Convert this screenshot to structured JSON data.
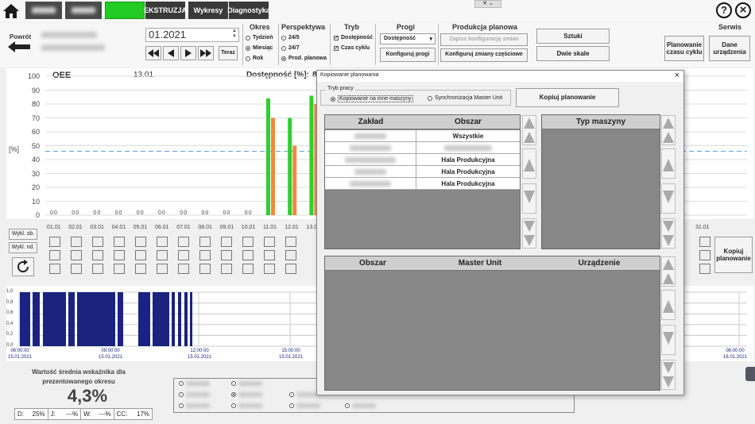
{
  "topbar": {
    "tabs": [
      {
        "label": "",
        "state": "blurred"
      },
      {
        "label": "",
        "state": "blurred"
      },
      {
        "label": "",
        "state": "active"
      },
      {
        "label": "EKSTRUZJA",
        "state": "normal"
      },
      {
        "label": "Wykresy",
        "state": "normal"
      },
      {
        "label": "Diagnostyka",
        "state": "normal"
      }
    ],
    "help_label": "?",
    "close_label": "×",
    "serwis_label": "Serwis"
  },
  "toolbar": {
    "back_label": "Powrót",
    "date_value": "01.2021",
    "today_label": "Teraz",
    "okres": {
      "title": "Okres",
      "options": [
        "Tydzień",
        "Miesiąc",
        "Rok"
      ],
      "selected": 1
    },
    "perspektywa": {
      "title": "Perspektywa",
      "options": [
        "24/5",
        "24/7",
        "Prod. planowa"
      ],
      "selected": 2
    },
    "tryb": {
      "title": "Tryb",
      "options": [
        "Dostępność",
        "Czas cyklu"
      ]
    },
    "progi": {
      "title": "Progi",
      "select_value": "Dostępność",
      "configure_label": "Konfiguruj progi"
    },
    "produkcja": {
      "title": "Produkcja planowa",
      "save_label": "Zapisz konfigurację zmian",
      "config_label": "Konfiguruj zmiany częściowe"
    },
    "sztuki_label": "Sztuki",
    "dwie_skale_label": "Dwie skale",
    "planowanie_label": "Planowanie czasu cyklu",
    "dane_label": "Dane urządzenia"
  },
  "chart": {
    "title": "OEE",
    "date_label": "13.01",
    "dostepnosc_label": "Dostępność [%]:",
    "dostepnosc_value": "8",
    "y_unit": "[%]",
    "y_ticks": [
      "100",
      "90",
      "80",
      "70",
      "60",
      "50",
      "40",
      "30",
      "20",
      "10",
      "0"
    ],
    "x_labels": [
      "01.01",
      "02.01",
      "03.01",
      "04.01",
      "05.01",
      "06.01",
      "07.01",
      "08.01",
      "09.01",
      "10.01",
      "11.01",
      "12.01",
      "13.01",
      "31.01"
    ],
    "zero_label": "0 0",
    "wykl_sb_label": "Wykl. sb.",
    "wykl_nd_label": "Wykl. nd.",
    "kopiuj_label": "Kopiuj planowanie"
  },
  "chart_data": {
    "type": "bar",
    "categories": [
      "01.01",
      "02.01",
      "03.01",
      "04.01",
      "05.01",
      "06.01",
      "07.01",
      "08.01",
      "09.01",
      "10.01",
      "11.01",
      "12.01",
      "13.01"
    ],
    "series": [
      {
        "values": [
          0,
          0,
          0,
          0,
          0,
          0,
          0,
          0,
          0,
          0,
          84,
          70,
          86
        ],
        "color": "#33cc33"
      },
      {
        "values": [
          0,
          0,
          0,
          0,
          0,
          0,
          0,
          0,
          0,
          0,
          70,
          50,
          80
        ],
        "color": "#f08a3c"
      }
    ],
    "threshold": 46,
    "ylim": [
      0,
      100
    ]
  },
  "timeline": {
    "y_ticks": [
      "1,0",
      "0,8",
      "0,6",
      "0,4",
      "0,2",
      "0,0"
    ],
    "x_labels": [
      {
        "time": "06:00:00",
        "date": "15.01.2021"
      },
      {
        "time": "09:00:00",
        "date": "15.01.2021"
      },
      {
        "time": "12:00:00",
        "date": "15.01.2021"
      },
      {
        "time": "15:00:00",
        "date": "15.01.2021"
      },
      {
        "time": "06:00:00",
        "date": "16.01.2021"
      }
    ]
  },
  "summary": {
    "caption": "Wartość średnia wskaźnika dla prezentowanego okresu",
    "value": "4,3%",
    "stats": [
      {
        "label": "D:",
        "value": "25%"
      },
      {
        "label": "J:",
        "value": "---%"
      },
      {
        "label": "W:",
        "value": "---%"
      },
      {
        "label": "CC:",
        "value": "17%"
      }
    ]
  },
  "dialog": {
    "title": "Kopiowanie planowania",
    "close_label": "×",
    "tryb_title": "Tryb pracy",
    "mode_copy": "Kopiowanie na inne maszyny",
    "mode_sync": "Synchronizacja Master Unit",
    "copy_button": "Kopiuj planowanie",
    "table1": {
      "headers": [
        "Zakład",
        "Obszar"
      ],
      "rows": [
        {
          "zaklad": "",
          "obszar": "Wszystkie"
        },
        {
          "zaklad": "",
          "obszar": ""
        },
        {
          "zaklad": "",
          "obszar": "Hala Produkcyjna"
        },
        {
          "zaklad": "",
          "obszar": "Hala Produkcyjna"
        },
        {
          "zaklad": "",
          "obszar": "Hala Produkcyjna"
        }
      ]
    },
    "table2": {
      "headers": [
        "Typ maszyny"
      ]
    },
    "table3": {
      "headers": [
        "Obszar",
        "Master Unit",
        "Urządzenie"
      ]
    }
  }
}
